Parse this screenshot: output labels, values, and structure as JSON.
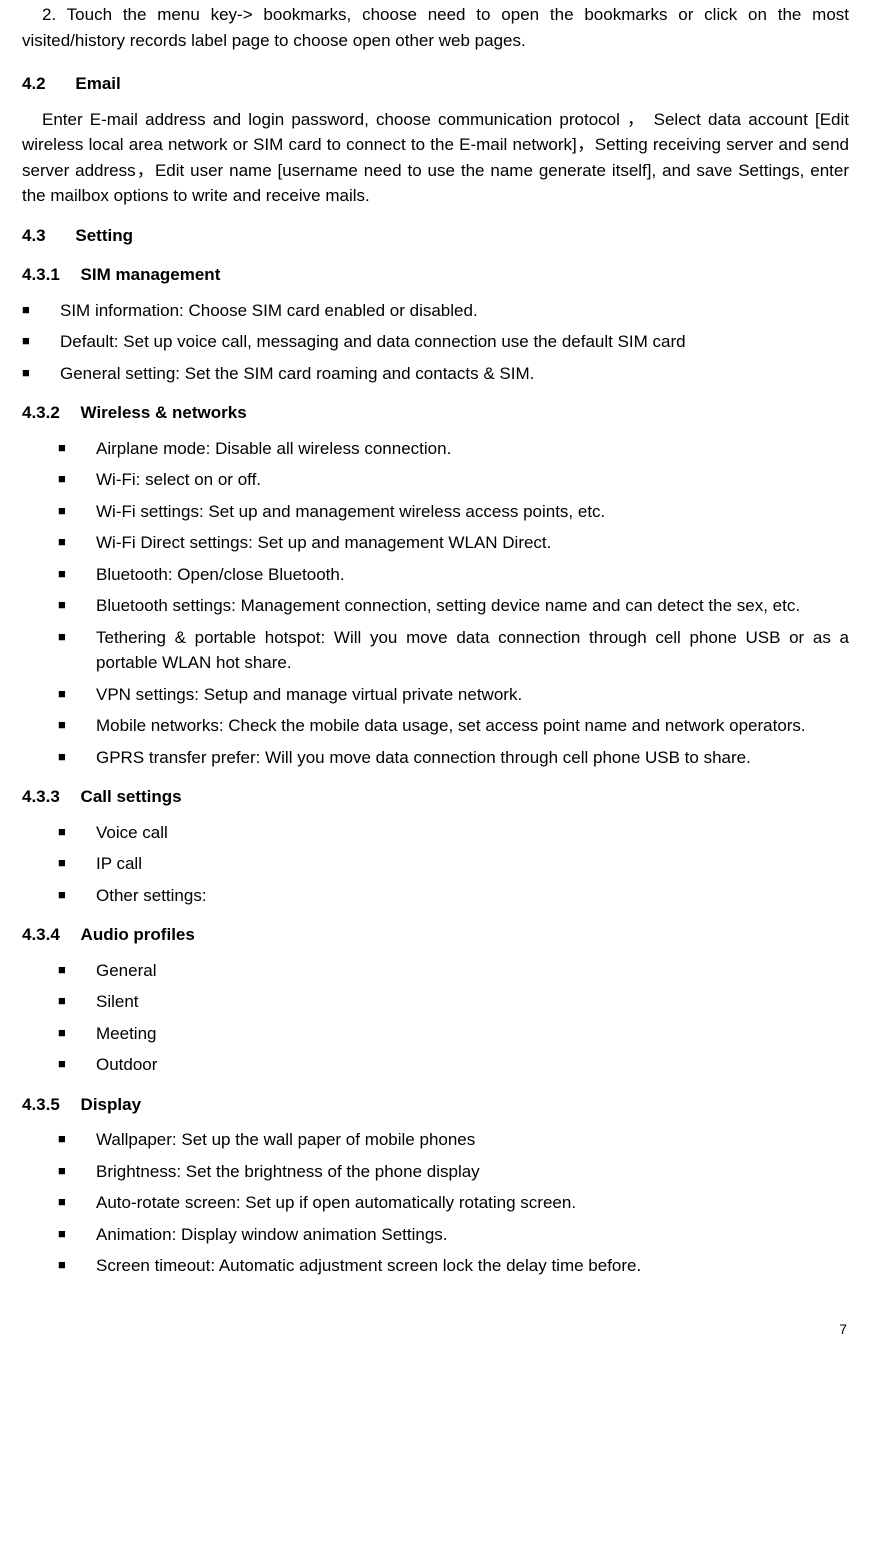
{
  "intro": {
    "p1": "2. Touch the menu key-> bookmarks, choose need to open the bookmarks or click on the most visited/history records label page to choose open other web pages."
  },
  "sec_email": {
    "num": "4.2",
    "title": "Email",
    "body": "Enter E-mail address and login password, choose communication protocol ， Select data account [Edit wireless local area network or SIM card to connect to the E-mail network]，Setting receiving server and send server address，Edit user name [username need to use the name generate itself], and save Settings, enter the mailbox options to write and receive mails."
  },
  "sec_setting": {
    "num": "4.3",
    "title": "Setting"
  },
  "s431": {
    "num": "4.3.1",
    "title": "SIM management",
    "items": [
      "SIM information: Choose SIM card enabled or disabled.",
      "Default: Set up voice call, messaging and data connection use the default SIM card",
      "General setting: Set the SIM card roaming and contacts & SIM."
    ]
  },
  "s432": {
    "num": "4.3.2",
    "title": "Wireless & networks",
    "items": [
      "Airplane mode: Disable all wireless connection.",
      "Wi-Fi: select on or off.",
      "Wi-Fi settings: Set up and management wireless access points, etc.",
      "Wi-Fi Direct settings: Set up and management WLAN Direct.",
      "Bluetooth: Open/close Bluetooth.",
      "Bluetooth settings: Management connection, setting device name and can detect the sex, etc.",
      "Tethering & portable hotspot: Will you move data connection through cell phone USB or as a portable WLAN hot share.",
      "VPN settings: Setup and manage virtual private network.",
      "Mobile networks: Check the mobile data usage, set access point name and network operators.",
      "GPRS transfer prefer: Will you move data connection through cell phone USB to share."
    ]
  },
  "s433": {
    "num": "4.3.3",
    "title": "Call settings",
    "items": [
      "Voice call",
      "IP call",
      "Other settings:"
    ]
  },
  "s434": {
    "num": "4.3.4",
    "title": "Audio profiles",
    "items": [
      "General",
      "Silent",
      "Meeting",
      "Outdoor"
    ]
  },
  "s435": {
    "num": "4.3.5",
    "title": "Display",
    "items": [
      "Wallpaper: Set up the wall paper of mobile phones",
      "Brightness: Set the brightness of the phone display",
      "Auto-rotate screen: Set up if open automatically rotating screen.",
      "Animation: Display window animation Settings.",
      "Screen timeout: Automatic adjustment screen lock the delay time before."
    ]
  },
  "page_number": "7"
}
